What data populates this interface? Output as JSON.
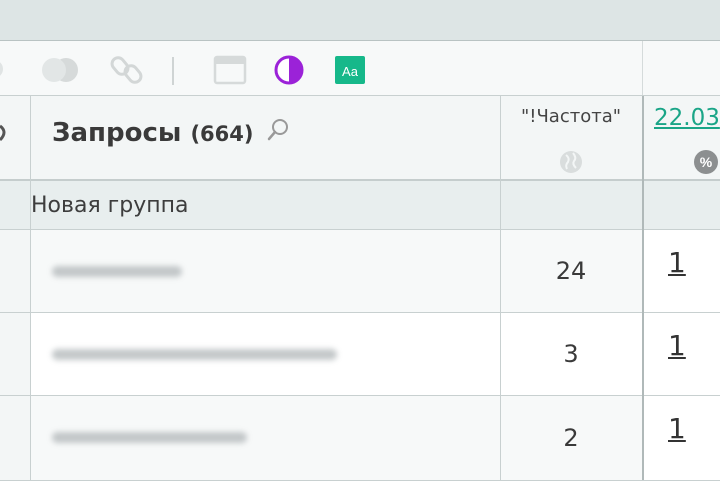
{
  "toolbar": {
    "icons": [
      "toggle-icon",
      "link-icon",
      "panel-icon",
      "contrast-icon",
      "font-case-icon"
    ],
    "font_case_label": "Aa",
    "accent_purple": "#9b22d8",
    "accent_green": "#16b88a"
  },
  "table": {
    "header": {
      "query_title": "Запросы",
      "query_count": "(664)",
      "freq_title": "\"!Частота\"",
      "date_link": "22.03",
      "percent_label": "%"
    },
    "group": {
      "label": "Новая группа"
    },
    "rows": [
      {
        "freq": "24",
        "position": "1"
      },
      {
        "freq": "3",
        "position": "1"
      },
      {
        "freq": "2",
        "position": "1"
      }
    ]
  }
}
